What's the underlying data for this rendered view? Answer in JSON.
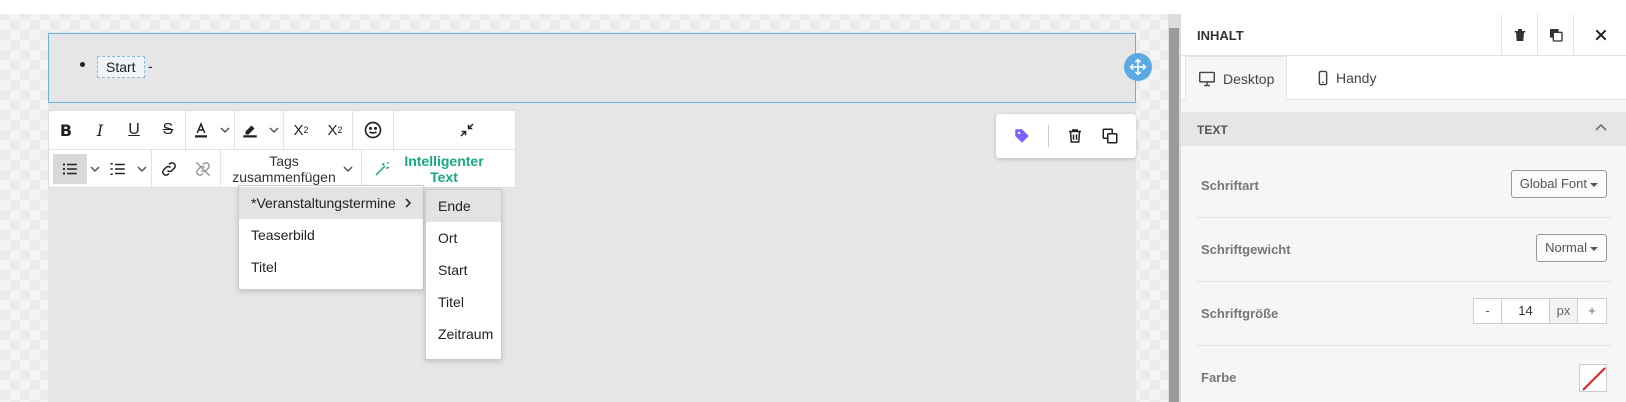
{
  "editor": {
    "list_item_tag": "Start",
    "list_item_after": "-"
  },
  "toolbar": {
    "merge_tags_label": "Tags zusammenfügen",
    "smart_text_label": "Intelligenter Text"
  },
  "merge_menu": {
    "items": [
      {
        "label": "*Veranstaltungstermine",
        "has_submenu": true
      },
      {
        "label": "Teaserbild"
      },
      {
        "label": "Titel"
      }
    ],
    "submenu": [
      "Ende",
      "Ort",
      "Start",
      "Titel",
      "Zeitraum"
    ],
    "submenu_highlighted": "Ende"
  },
  "panel": {
    "title": "INHALT",
    "tabs": [
      "Desktop",
      "Handy"
    ],
    "active_tab": "Desktop",
    "section": "TEXT",
    "font_label": "Schriftart",
    "font_value": "Global Font",
    "weight_label": "Schriftgewicht",
    "weight_value": "Normal",
    "size_label": "Schriftgröße",
    "size_minus": "-",
    "size_value": "14",
    "size_unit": "px",
    "size_plus": "+",
    "color_label": "Farbe"
  },
  "colors": {
    "accent": "#5aa9e4",
    "smart_text": "#17a984",
    "tag_icon": "#7b61ff",
    "no_color_slash": "#e02020"
  },
  "icons": [
    "move-icon",
    "tag-icon",
    "trash-icon",
    "duplicate-icon",
    "bold-icon",
    "italic-icon",
    "underline-icon",
    "strikethrough-icon",
    "font-color-icon",
    "highlight-icon",
    "superscript-icon",
    "subscript-icon",
    "emoji-icon",
    "collapse-icon",
    "bullet-list-icon",
    "numbered-list-icon",
    "link-icon",
    "unlink-icon",
    "magic-wand-icon",
    "close-icon",
    "desktop-icon",
    "mobile-icon",
    "chevron-up-icon"
  ]
}
